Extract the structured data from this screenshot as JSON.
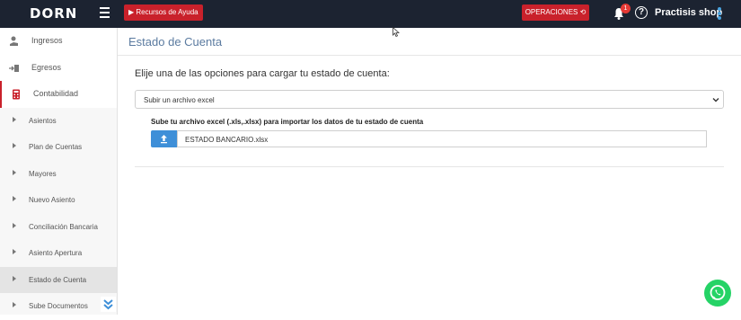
{
  "header": {
    "logo": "DORN",
    "help_button": "Recursos de Ayuda",
    "operations_button": "OPERACIONES",
    "notification_count": "1",
    "help_icon": "?",
    "shop_name": "Practisis shop",
    "colors": {
      "bar": "#1c2331",
      "accent": "#c9212b",
      "kebab": "#4aa3df"
    }
  },
  "sidebar": {
    "main_items": [
      {
        "label": "Ingresos",
        "icon": "money-hand-icon"
      },
      {
        "label": "Egresos",
        "icon": "money-out-icon"
      },
      {
        "label": "Contabilidad",
        "icon": "calculator-icon"
      }
    ],
    "sub_items": [
      {
        "label": "Asientos"
      },
      {
        "label": "Plan de Cuentas"
      },
      {
        "label": "Mayores"
      },
      {
        "label": "Nuevo Asiento"
      },
      {
        "label": "Conciliación Bancaria"
      },
      {
        "label": "Asiento Apertura"
      },
      {
        "label": "Estado de Cuenta"
      },
      {
        "label": "Sube Documentos"
      }
    ],
    "selected_item": "Estado de Cuenta"
  },
  "main": {
    "page_title": "Estado de Cuenta",
    "prompt": "Elije una de las opciones para cargar tu estado de cuenta:",
    "select_value": "Subir un archivo excel",
    "upload_label": "Sube tu archivo excel (.xls,.xlsx) para importar los datos de tu estado de cuenta",
    "file_name": "ESTADO BANCARIO.xlsx"
  }
}
